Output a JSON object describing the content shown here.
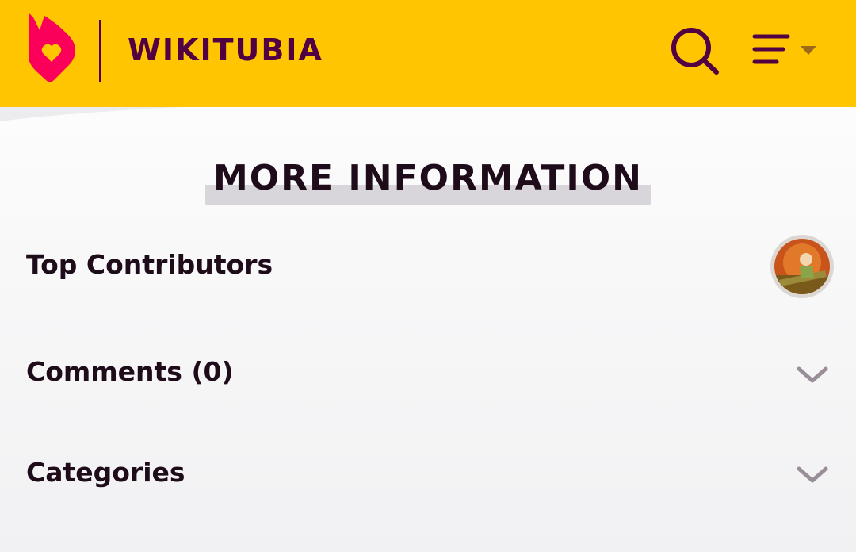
{
  "header": {
    "site_name": "WIKITUBIA",
    "brand_color": "#ffc500",
    "logo_color": "#fa005a",
    "text_color": "#520044"
  },
  "section": {
    "title": "MORE INFORMATION"
  },
  "rows": [
    {
      "label": "Top Contributors",
      "trailing": "avatar"
    },
    {
      "label": "Comments (0)",
      "trailing": "chevron-down-icon"
    },
    {
      "label": "Categories",
      "trailing": "chevron-down-icon"
    }
  ]
}
